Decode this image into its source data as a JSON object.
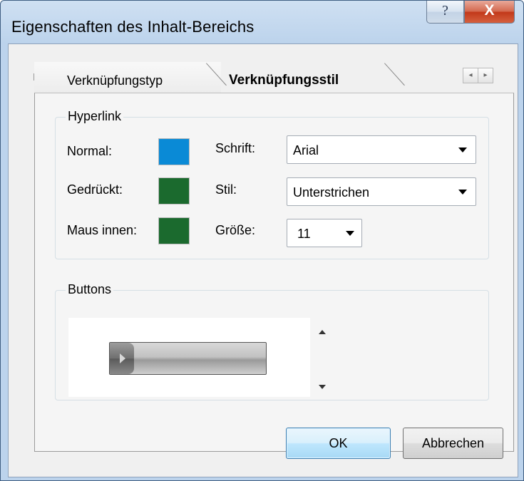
{
  "window": {
    "title": "Eigenschaften des Inhalt-Bereichs",
    "help_glyph": "?",
    "close_glyph": "X"
  },
  "tabs": [
    {
      "label": "Verknüpfungstyp",
      "active": false
    },
    {
      "label": "Verknüpfungsstil",
      "active": true
    }
  ],
  "tab_scroll": {
    "left_glyph": "◂",
    "right_glyph": "▸"
  },
  "hyperlink_group": {
    "title": "Hyperlink",
    "normal_label": "Normal:",
    "pressed_label": "Gedrückt:",
    "hover_label": "Maus innen:",
    "colors": {
      "normal": "#0a8ad6",
      "pressed": "#1b6a2e",
      "hover": "#1b6a2e"
    },
    "font_label": "Schrift:",
    "font_value": "Arial",
    "style_label": "Stil:",
    "style_value": "Unterstrichen",
    "size_label": "Größe:",
    "size_value": "11"
  },
  "buttons_group": {
    "title": "Buttons"
  },
  "footer": {
    "ok_label": "OK",
    "cancel_label": "Abbrechen"
  }
}
